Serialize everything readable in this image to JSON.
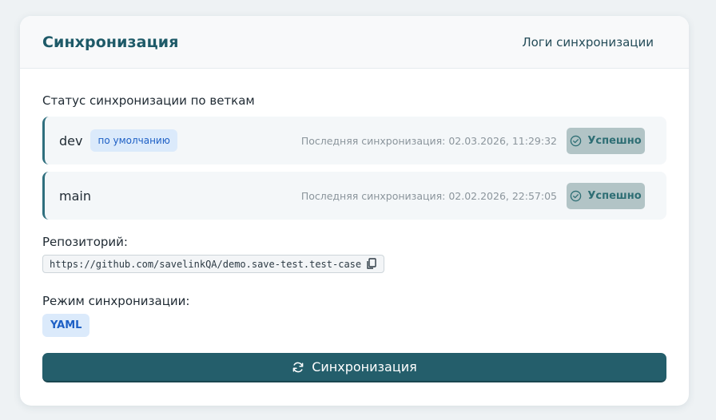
{
  "header": {
    "title": "Синхронизация",
    "logs_link": "Логи синхронизации"
  },
  "branches_section": {
    "title": "Статус синхронизации по веткам",
    "branches": [
      {
        "name": "dev",
        "default_badge": "по умолчанию",
        "last_sync": "Последняя синхронизация: 02.03.2026, 11:29:32",
        "status": "Успешно",
        "status_icon": "check-circle-icon"
      },
      {
        "name": "main",
        "last_sync": "Последняя синхронизация: 02.02.2026, 22:57:05",
        "status": "Успешно",
        "status_icon": "check-circle-icon"
      }
    ]
  },
  "repository": {
    "label": "Репозиторий:",
    "url": "https://github.com/savelinkQA/demo.save-test.test-case",
    "copy_icon": "copy-icon"
  },
  "mode": {
    "label": "Режим синхронизации:",
    "value": "YAML"
  },
  "sync_button": {
    "label": "Синхронизация",
    "icon": "refresh-icon"
  },
  "colors": {
    "accent": "#245e6b",
    "title": "#1e5a68",
    "badge_bg": "#dbeafb",
    "badge_text": "#1d5fc5",
    "status_bg": "#b2c4c6",
    "status_text": "#2e6e74"
  }
}
